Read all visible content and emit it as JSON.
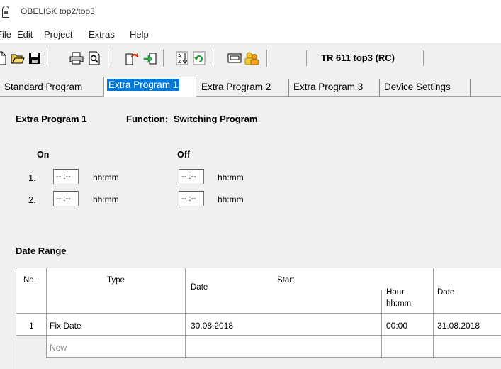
{
  "window": {
    "title": "OBELISK top2/top3"
  },
  "menu": {
    "items": [
      "File",
      "Edit",
      "Project",
      "Extras",
      "Help"
    ]
  },
  "toolbar": {
    "device_label": "TR 611 top3 (RC)"
  },
  "tabs": [
    "Standard Program",
    "Extra Program 1",
    "Extra Program 2",
    "Extra Program 3",
    "Device Settings"
  ],
  "program": {
    "name": "Extra Program 1",
    "function_label": "Function:",
    "function_value": "Switching Program",
    "on_label": "On",
    "off_label": "Off",
    "rows": [
      {
        "index": "1.",
        "on": "-- :--",
        "on_unit": "hh:mm",
        "off": "-- :--",
        "off_unit": "hh:mm"
      },
      {
        "index": "2.",
        "on": "-- :--",
        "on_unit": "hh:mm",
        "off": "-- :--",
        "off_unit": "hh:mm"
      }
    ]
  },
  "date_range": {
    "title": "Date Range",
    "headers": {
      "no": "No.",
      "type": "Type",
      "start": "Start",
      "date": "Date",
      "hour": "Hour",
      "hour_unit": "hh:mm",
      "end_date": "Date"
    },
    "rows": [
      {
        "no": "1",
        "type": "Fix Date",
        "start_date": "30.08.2018",
        "hour": "00:00",
        "end_date": "31.08.2018"
      },
      {
        "no": "",
        "type": "New",
        "start_date": "",
        "hour": "",
        "end_date": ""
      }
    ]
  }
}
